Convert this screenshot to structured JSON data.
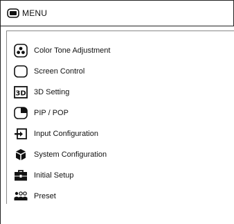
{
  "header": {
    "title": "MENU",
    "icon": "monitor-icon"
  },
  "menu": {
    "items": [
      {
        "label": "Color Tone Adjustment",
        "icon": "color-tone-icon"
      },
      {
        "label": "Screen Control",
        "icon": "screen-icon"
      },
      {
        "label": "3D Setting",
        "icon": "3d-icon"
      },
      {
        "label": "PIP / POP",
        "icon": "pip-icon"
      },
      {
        "label": "Input Configuration",
        "icon": "input-icon"
      },
      {
        "label": "System Configuration",
        "icon": "system-cube-icon"
      },
      {
        "label": "Initial Setup",
        "icon": "toolbox-icon"
      },
      {
        "label": "Preset",
        "icon": "users-icon"
      }
    ]
  }
}
